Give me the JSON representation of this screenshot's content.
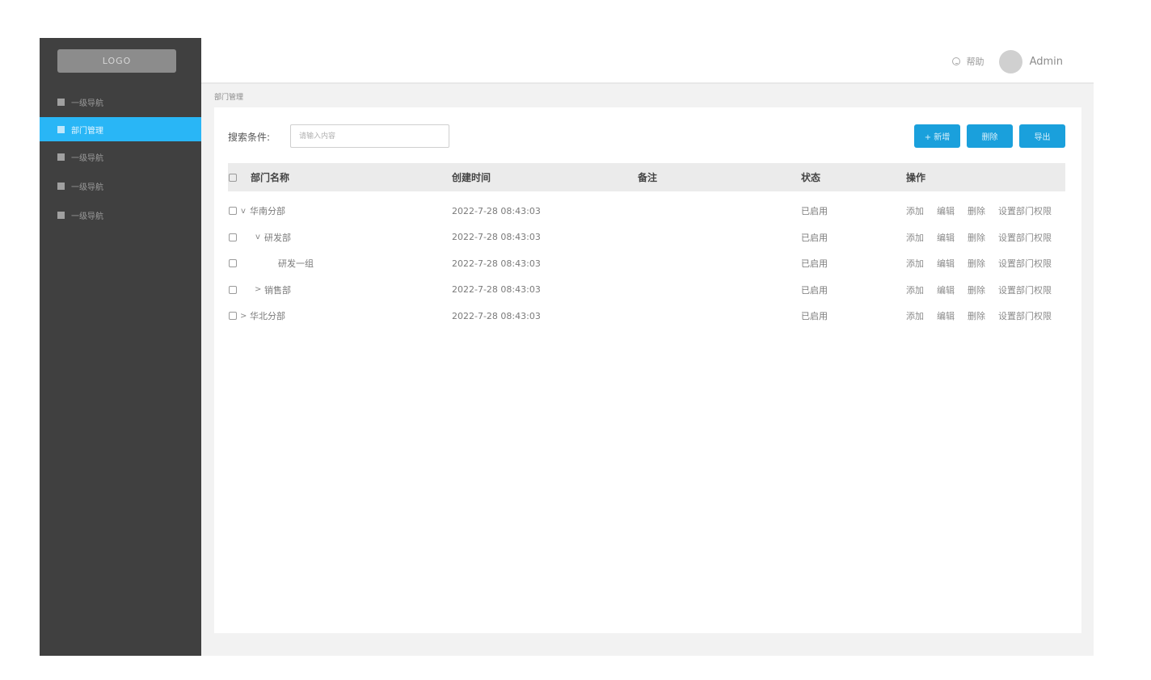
{
  "sidebar": {
    "logo": "LOGO",
    "items": [
      {
        "label": "一级导航",
        "active": false
      },
      {
        "label": "部门管理",
        "active": true
      },
      {
        "label": "一级导航",
        "active": false
      },
      {
        "label": "一级导航",
        "active": false
      },
      {
        "label": "一级导航",
        "active": false
      }
    ]
  },
  "header": {
    "help_label": "帮助",
    "help_icon": "help-circle-icon",
    "username": "Admin"
  },
  "breadcrumb": "部门管理",
  "search": {
    "label": "搜索条件:",
    "placeholder": "请输入内容",
    "value": ""
  },
  "toolbar": {
    "add_label": "+ 新增",
    "delete_label": "删除",
    "export_label": "导出"
  },
  "table": {
    "columns": [
      "部门名称",
      "创建时间",
      "备注",
      "状态",
      "操作"
    ],
    "rows": [
      {
        "name": "华南分部",
        "level": 1,
        "toggle": "v",
        "time": "2022-7-28 08:43:03",
        "remark": "",
        "status": "已启用"
      },
      {
        "name": "研发部",
        "level": 2,
        "toggle": "v",
        "time": "2022-7-28 08:43:03",
        "remark": "",
        "status": "已启用"
      },
      {
        "name": "研发一组",
        "level": 3,
        "toggle": "",
        "time": "2022-7-28 08:43:03",
        "remark": "",
        "status": "已启用"
      },
      {
        "name": "销售部",
        "level": 2,
        "toggle": ">",
        "time": "2022-7-28 08:43:03",
        "remark": "",
        "status": "已启用"
      },
      {
        "name": "华北分部",
        "level": 1,
        "toggle": ">",
        "time": "2022-7-28 08:43:03",
        "remark": "",
        "status": "已启用"
      }
    ],
    "row_actions": [
      "添加",
      "编辑",
      "删除",
      "设置部门权限"
    ]
  },
  "colors": {
    "sidebar_bg": "#404040",
    "accent": "#29b6f6",
    "button": "#1aa0dc"
  }
}
